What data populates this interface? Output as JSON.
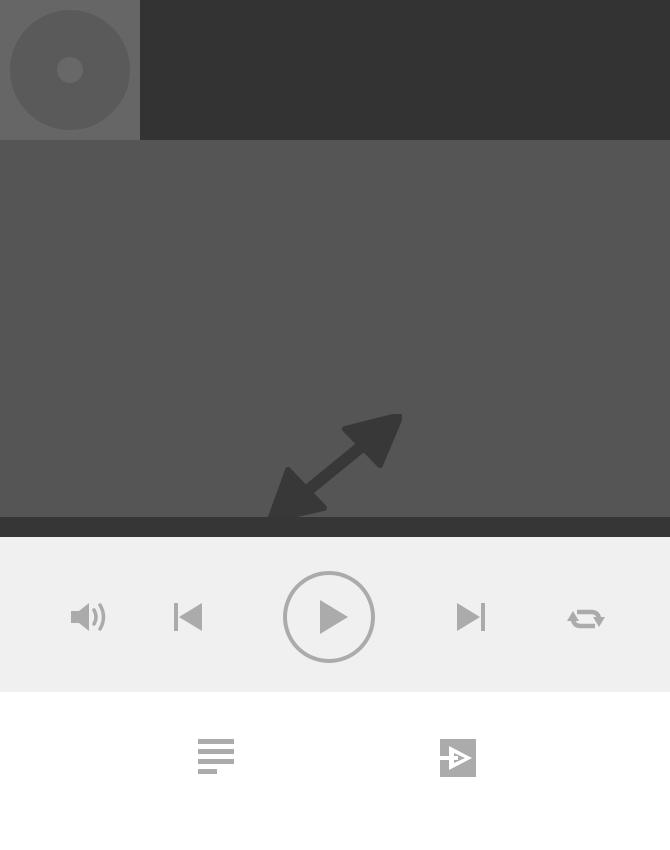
{
  "colors": {
    "header_bg": "#333333",
    "album_art_bg": "#666666",
    "video_bg": "#555555",
    "progress_track": "#363636",
    "controls_bg": "#f0f0f0",
    "icon_gray": "#ababab"
  },
  "player": {
    "progress_fraction": 0,
    "playing": false
  },
  "icons": {
    "album_art": "disc-icon",
    "video": "fullscreen-expand-icon",
    "volume": "volume-icon",
    "previous": "skip-previous-icon",
    "play": "play-icon",
    "next": "skip-next-icon",
    "repeat": "repeat-icon",
    "playlist": "playlist-icon",
    "playlist_add": "playlist-play-icon"
  }
}
